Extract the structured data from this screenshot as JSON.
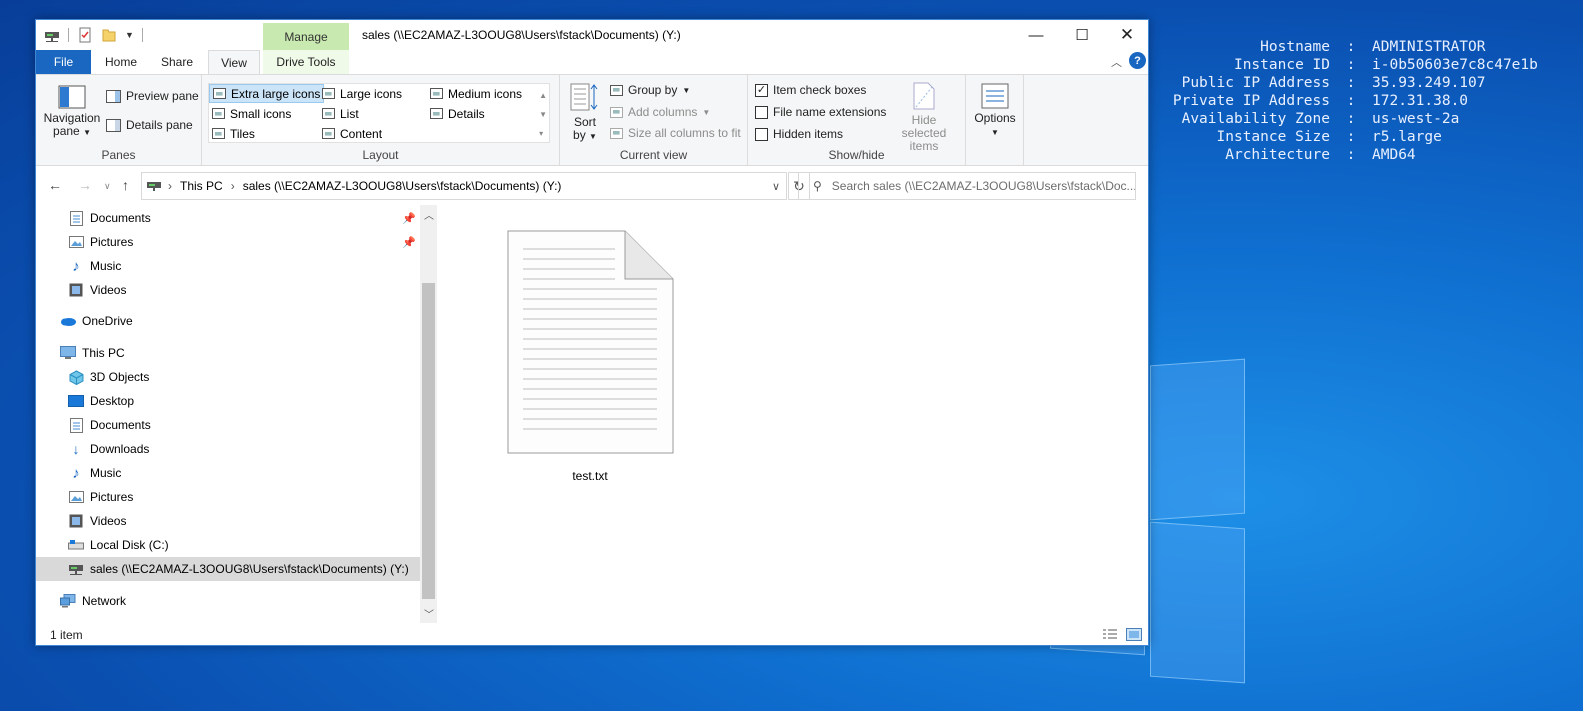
{
  "bginfo": [
    {
      "key": "Hostname",
      "value": "ADMINISTRATOR"
    },
    {
      "key": "Instance ID",
      "value": "i-0b50603e7c8c47e1b"
    },
    {
      "key": "Public IP Address",
      "value": "35.93.249.107"
    },
    {
      "key": "Private IP Address",
      "value": "172.31.38.0"
    },
    {
      "key": "Availability Zone",
      "value": "us-west-2a"
    },
    {
      "key": "Instance Size",
      "value": "r5.large"
    },
    {
      "key": "Architecture",
      "value": "AMD64"
    }
  ],
  "bginfo_sep": ":",
  "window": {
    "title": "sales (\\\\EC2AMAZ-L3OOUG8\\Users\\fstack\\Documents) (Y:)",
    "context_tab": "Manage"
  },
  "tabs": {
    "file": "File",
    "home": "Home",
    "share": "Share",
    "view": "View",
    "drive_tools": "Drive Tools"
  },
  "ribbon": {
    "panes": {
      "label": "Panes",
      "navigation_pane_1": "Navigation",
      "navigation_pane_2": "pane",
      "preview_pane": "Preview pane",
      "details_pane": "Details pane"
    },
    "layout": {
      "label": "Layout",
      "extra_large_icons": "Extra large icons",
      "large_icons": "Large icons",
      "medium_icons": "Medium icons",
      "small_icons": "Small icons",
      "list": "List",
      "details": "Details",
      "tiles": "Tiles",
      "content": "Content"
    },
    "current_view": {
      "label": "Current view",
      "sort_by_1": "Sort",
      "sort_by_2": "by",
      "group_by": "Group by",
      "add_columns": "Add columns",
      "size_columns": "Size all columns to fit"
    },
    "show_hide": {
      "label": "Show/hide",
      "item_check_boxes": "Item check boxes",
      "file_name_extensions": "File name extensions",
      "hidden_items": "Hidden items",
      "hide_selected_1": "Hide selected",
      "hide_selected_2": "items"
    },
    "options": "Options"
  },
  "address": {
    "crumb_this_pc": "This PC",
    "crumb_sales": "sales (\\\\EC2AMAZ-L3OOUG8\\Users\\fstack\\Documents) (Y:)",
    "search_placeholder": "Search sales (\\\\EC2AMAZ-L3OOUG8\\Users\\fstack\\Doc..."
  },
  "nav": {
    "documents_pinned": "Documents",
    "pictures_pinned": "Pictures",
    "music_quick": "Music",
    "videos_quick": "Videos",
    "onedrive": "OneDrive",
    "this_pc": "This PC",
    "objects3d": "3D Objects",
    "desktop": "Desktop",
    "documents": "Documents",
    "downloads": "Downloads",
    "music": "Music",
    "pictures": "Pictures",
    "videos": "Videos",
    "local_disk": "Local Disk (C:)",
    "sales_drive": "sales (\\\\EC2AMAZ-L3OOUG8\\Users\\fstack\\Documents) (Y:)",
    "network": "Network"
  },
  "files": [
    {
      "name": "test.txt"
    }
  ],
  "status": {
    "count": "1 item"
  }
}
